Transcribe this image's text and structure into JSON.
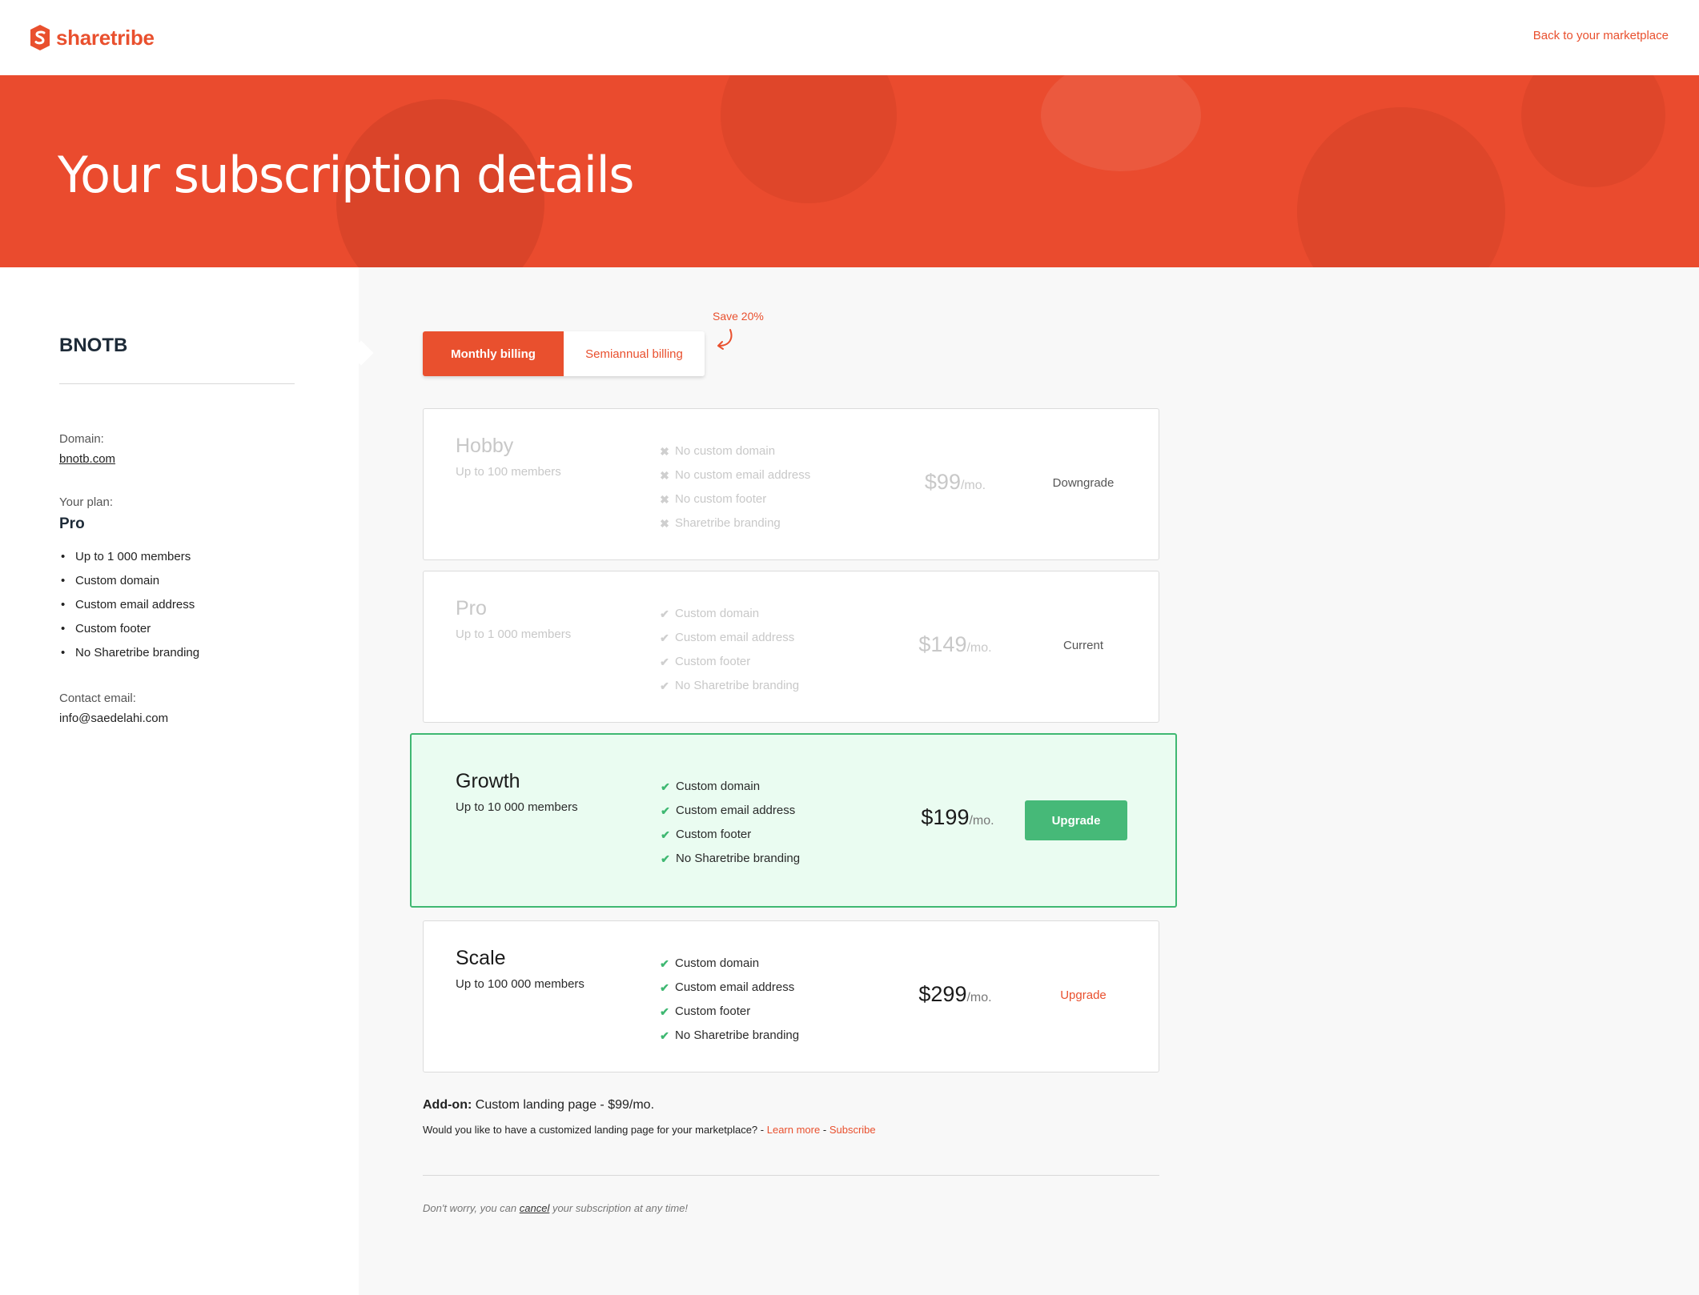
{
  "header": {
    "logo_text": "sharetribe",
    "back_link": "Back to your marketplace"
  },
  "hero": {
    "title": "Your subscription details"
  },
  "sidebar": {
    "marketplace_name": "BNOTB",
    "domain_label": "Domain:",
    "domain_value": "bnotb.com",
    "plan_label": "Your plan:",
    "plan_name": "Pro",
    "plan_features": [
      "Up to 1 000 members",
      "Custom domain",
      "Custom email address",
      "Custom footer",
      "No Sharetribe branding"
    ],
    "contact_label": "Contact email:",
    "contact_value": "info@saedelahi.com"
  },
  "billing": {
    "monthly_label": "Monthly billing",
    "semiannual_label": "Semiannual billing",
    "save_note": "Save 20%",
    "selected": "monthly"
  },
  "plans": [
    {
      "name": "Hobby",
      "members": "Up to 100 members",
      "features": [
        "No custom domain",
        "No custom email address",
        "No custom footer",
        "Sharetribe branding"
      ],
      "feature_icon": "cross-icon",
      "price": "$99",
      "per": "/mo.",
      "action": "Downgrade",
      "state": "faded"
    },
    {
      "name": "Pro",
      "members": "Up to 1 000 members",
      "features": [
        "Custom domain",
        "Custom email address",
        "Custom footer",
        "No Sharetribe branding"
      ],
      "feature_icon": "check-icon",
      "price": "$149",
      "per": "/mo.",
      "action": "Current",
      "state": "faded"
    },
    {
      "name": "Growth",
      "members": "Up to 10 000 members",
      "features": [
        "Custom domain",
        "Custom email address",
        "Custom footer",
        "No Sharetribe branding"
      ],
      "feature_icon": "check-icon",
      "price": "$199",
      "per": "/mo.",
      "action": "Upgrade",
      "state": "highlight"
    },
    {
      "name": "Scale",
      "members": "Up to 100 000 members",
      "features": [
        "Custom domain",
        "Custom email address",
        "Custom footer",
        "No Sharetribe branding"
      ],
      "feature_icon": "check-icon",
      "price": "$299",
      "per": "/mo.",
      "action": "Upgrade",
      "state": "normal"
    }
  ],
  "addon": {
    "label": "Add-on:",
    "text": "Custom landing page - $99/mo.",
    "question": "Would you like to have a customized landing page for your marketplace? -",
    "learn_more": "Learn more",
    "separator": "-",
    "subscribe": "Subscribe"
  },
  "footnote": {
    "before": "Don't worry, you can",
    "link": "cancel",
    "after": "your subscription at any time!"
  },
  "colors": {
    "brand": "#e9502e",
    "success": "#46b978",
    "highlight_bg": "#eafcf1"
  }
}
